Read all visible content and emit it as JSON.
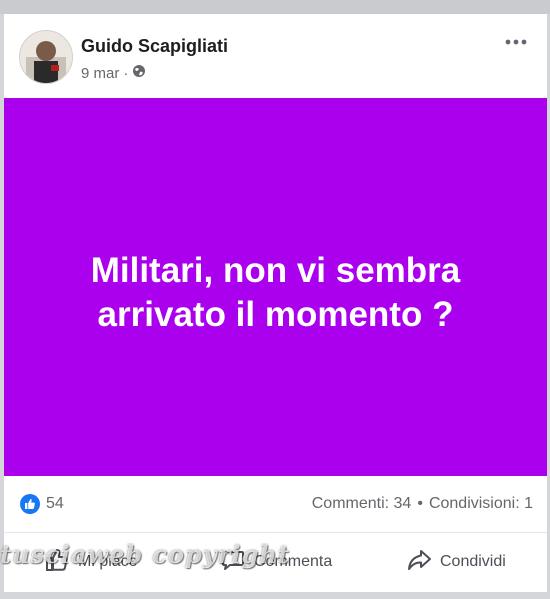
{
  "post": {
    "author": "Guido Scapigliati",
    "date": "9 mar",
    "separator": "·",
    "privacy_icon": "globe-icon",
    "menu_icon": "more-options-icon"
  },
  "banner": {
    "text": "Militari, non vi sembra arrivato il momento ?",
    "background": "#aa00ee",
    "text_color": "#ffffff"
  },
  "stats": {
    "reaction_icon": "like-icon",
    "likes": "54",
    "comments": "Commenti: 34",
    "dot": "•",
    "shares": "Condivisioni: 1"
  },
  "actions": {
    "like": "Mi piace",
    "comment": "Commenta",
    "share": "Condividi"
  },
  "watermark": "tusciaweb copyright",
  "colors": {
    "accent": "#1877f2",
    "muted_text": "#65676b"
  }
}
